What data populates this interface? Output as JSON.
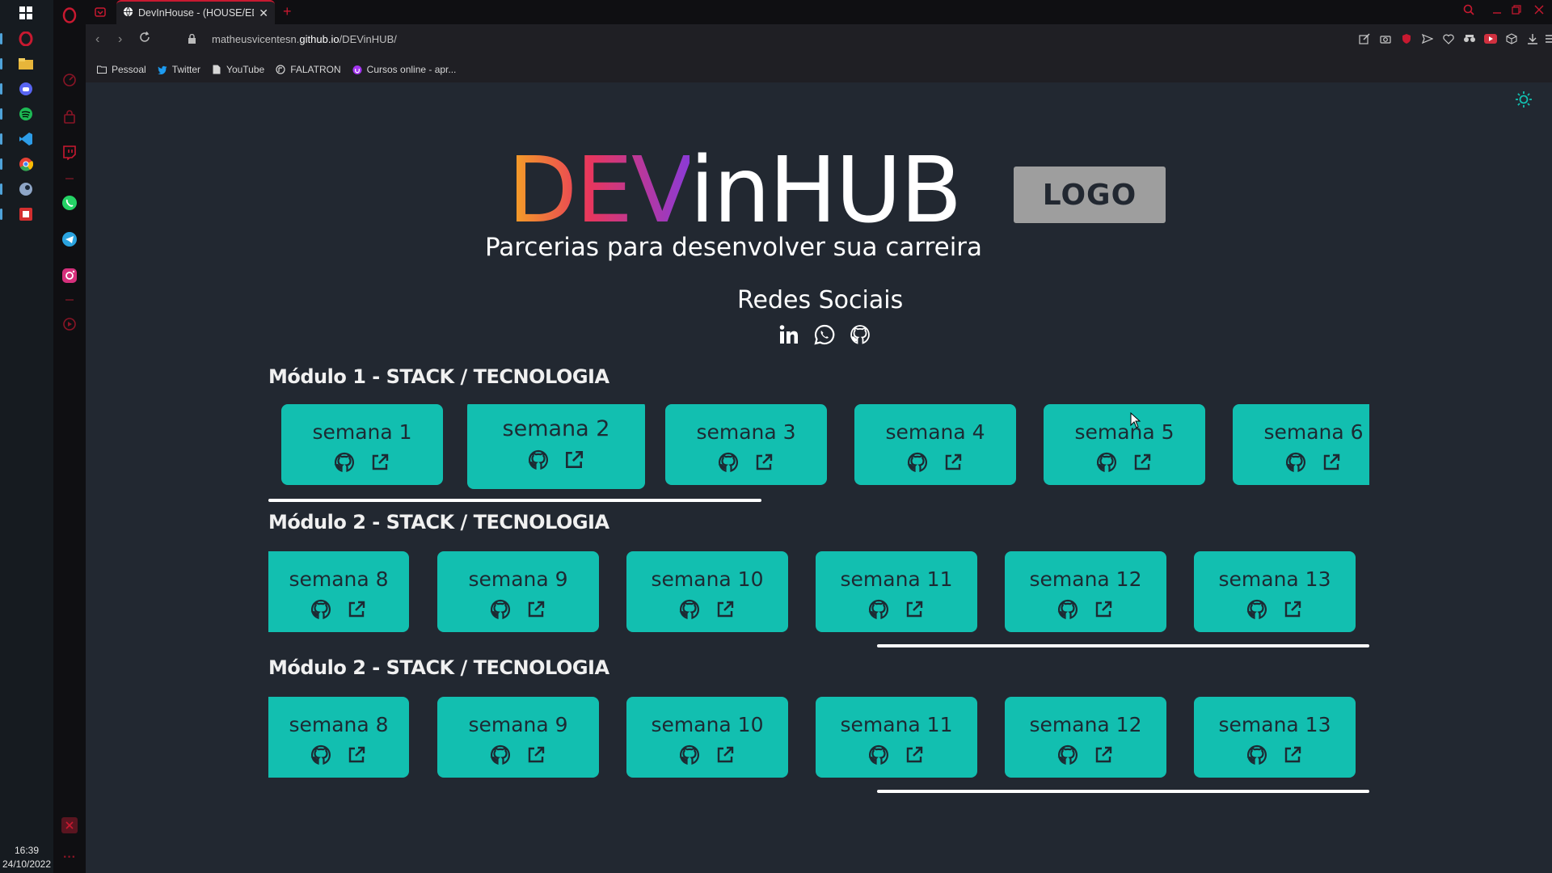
{
  "taskbar": {
    "time": "16:39",
    "date": "24/10/2022",
    "apps": [
      "windows-start-icon",
      "opera-icon",
      "file-explorer-icon",
      "discord-icon",
      "spotify-icon",
      "vscode-icon",
      "chrome-icon",
      "steam-icon",
      "app-red-icon"
    ]
  },
  "browser": {
    "tab_title": "DevInHouse - (HOUSE/EDI",
    "url_prefix": "matheusvicentesn.",
    "url_domain": "github.io",
    "url_path": "/DEVinHUB/",
    "bookmarks": [
      {
        "label": "Pessoal",
        "icon": "folder-icon"
      },
      {
        "label": "Twitter",
        "icon": "twitter-icon"
      },
      {
        "label": "YouTube",
        "icon": "page-icon"
      },
      {
        "label": "FALATRON",
        "icon": "falatron-icon"
      },
      {
        "label": "Cursos online - apr...",
        "icon": "udemy-icon"
      }
    ]
  },
  "hero": {
    "title_part1": "DEV",
    "title_part2": "inHUB",
    "subtitle": "Parcerias para desenvolver sua carreira",
    "logo_text": "LOGO"
  },
  "social": {
    "title": "Redes Sociais",
    "icons": [
      "linkedin-icon",
      "whatsapp-icon",
      "github-icon"
    ]
  },
  "modules": [
    {
      "title": "Módulo 1 - STACK / TECNOLOGIA",
      "weeks": [
        "semana 1",
        "semana 2",
        "semana 3",
        "semana 4",
        "semana 5",
        "semana 6"
      ]
    },
    {
      "title": "Módulo 2 - STACK / TECNOLOGIA",
      "weeks": [
        "semana 8",
        "semana 9",
        "semana 10",
        "semana 11",
        "semana 12",
        "semana 13"
      ]
    },
    {
      "title": "Módulo 2 - STACK / TECNOLOGIA",
      "weeks": [
        "semana 8",
        "semana 9",
        "semana 10",
        "semana 11",
        "semana 12",
        "semana 13"
      ]
    }
  ],
  "colors": {
    "accent": "#12bfb0",
    "background": "#222831",
    "opera_red": "#c81930"
  }
}
